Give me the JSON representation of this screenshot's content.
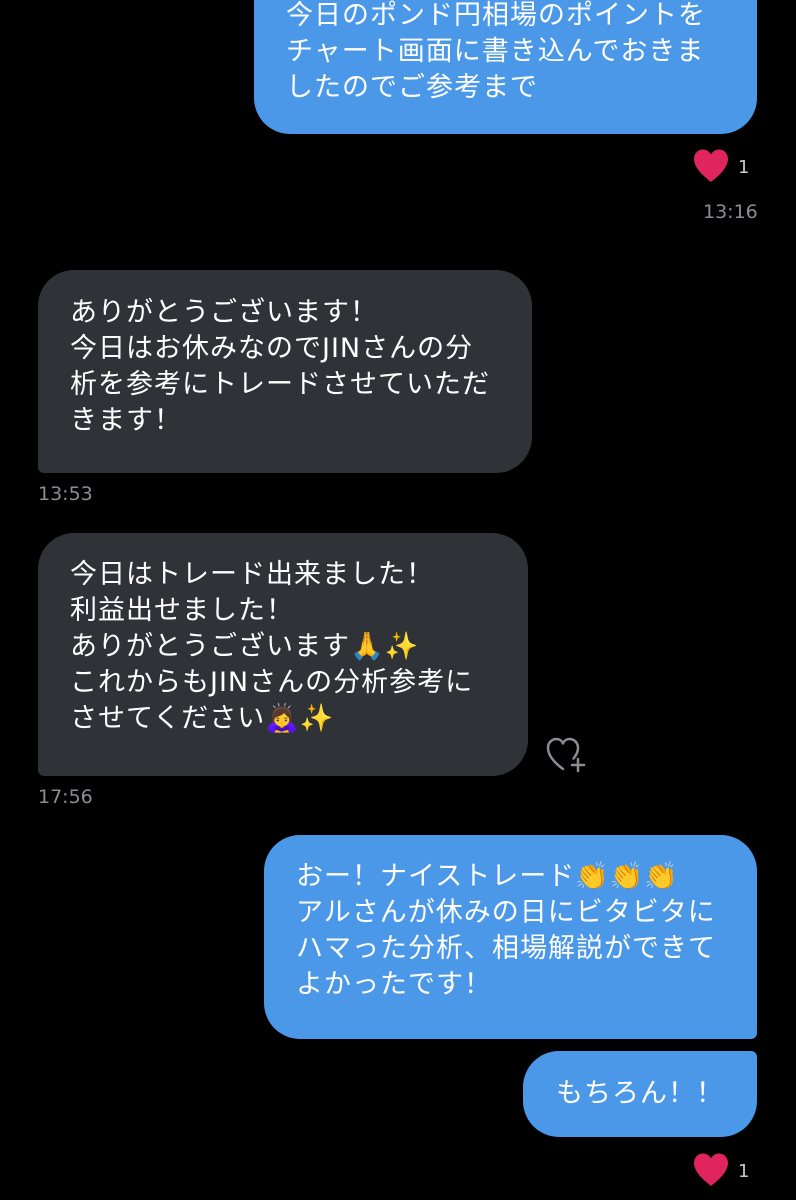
{
  "colors": {
    "background": "#000000",
    "my_bubble": "#4c98e8",
    "their_bubble": "#2f3236",
    "timestamp": "#8a8d91",
    "heart": "#e0245e"
  },
  "messages": [
    {
      "sender": "me",
      "text": "今日のポンド円相場のポイントを\nチャート画面に書き込んでおきま\nしたのでご参考まで",
      "reaction": {
        "icon": "heart-icon",
        "count": "1"
      },
      "time": "13:16"
    },
    {
      "sender": "them",
      "text": "ありがとうございます！\n今日はお休みなのでJINさんの分\n析を参考にトレードさせていただ\nきます！",
      "time": "13:53"
    },
    {
      "sender": "them",
      "text": "今日はトレード出来ました！\n利益出せました！\nありがとうございます🙏✨\nこれからもJINさんの分析参考に\nさせてください🙇‍♀️✨",
      "add_reaction_icon": "heart-plus-icon",
      "time": "17:56"
    },
    {
      "sender": "me",
      "text": "おー！ナイストレード👏👏👏\nアルさんが休みの日にビタビタに\nハマった分析、相場解説ができて\nよかったです！"
    },
    {
      "sender": "me",
      "text": "もちろん！！",
      "reaction": {
        "icon": "heart-icon",
        "count": "1"
      }
    }
  ]
}
